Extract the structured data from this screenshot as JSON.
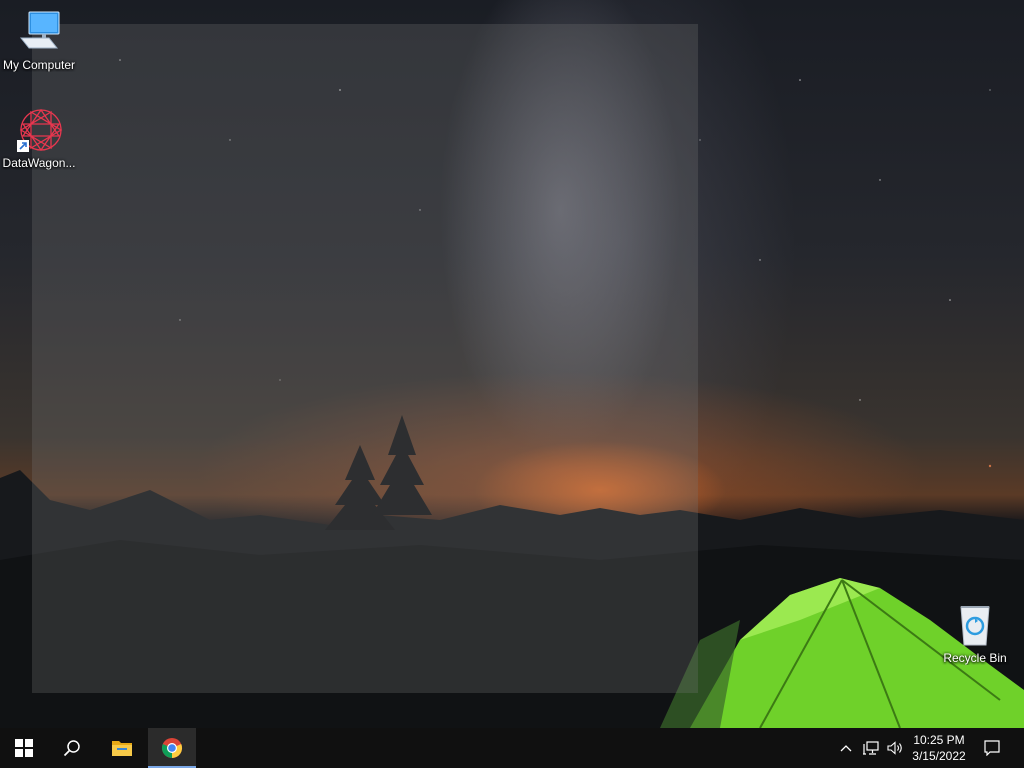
{
  "desktop": {
    "icons": [
      {
        "label": "My Computer",
        "icon": "computer-icon"
      },
      {
        "label": "DataWagon...",
        "icon": "datawagon-icon"
      },
      {
        "label": "Recycle Bin",
        "icon": "recycle-bin-icon"
      }
    ]
  },
  "taskbar": {
    "start": {
      "icon": "windows-start-icon"
    },
    "search": {
      "icon": "search-icon"
    },
    "pinned": [
      {
        "icon": "file-explorer-icon"
      },
      {
        "icon": "chrome-icon",
        "active": true
      }
    ],
    "tray": {
      "overflow_icon": "chevron-up-icon",
      "network_icon": "network-icon",
      "volume_icon": "volume-icon",
      "notification_icon": "action-center-icon"
    },
    "clock": {
      "time": "10:25 PM",
      "date": "3/15/2022"
    }
  },
  "colors": {
    "taskbar_bg": "#101010",
    "active_indicator": "#7aa7e6"
  }
}
